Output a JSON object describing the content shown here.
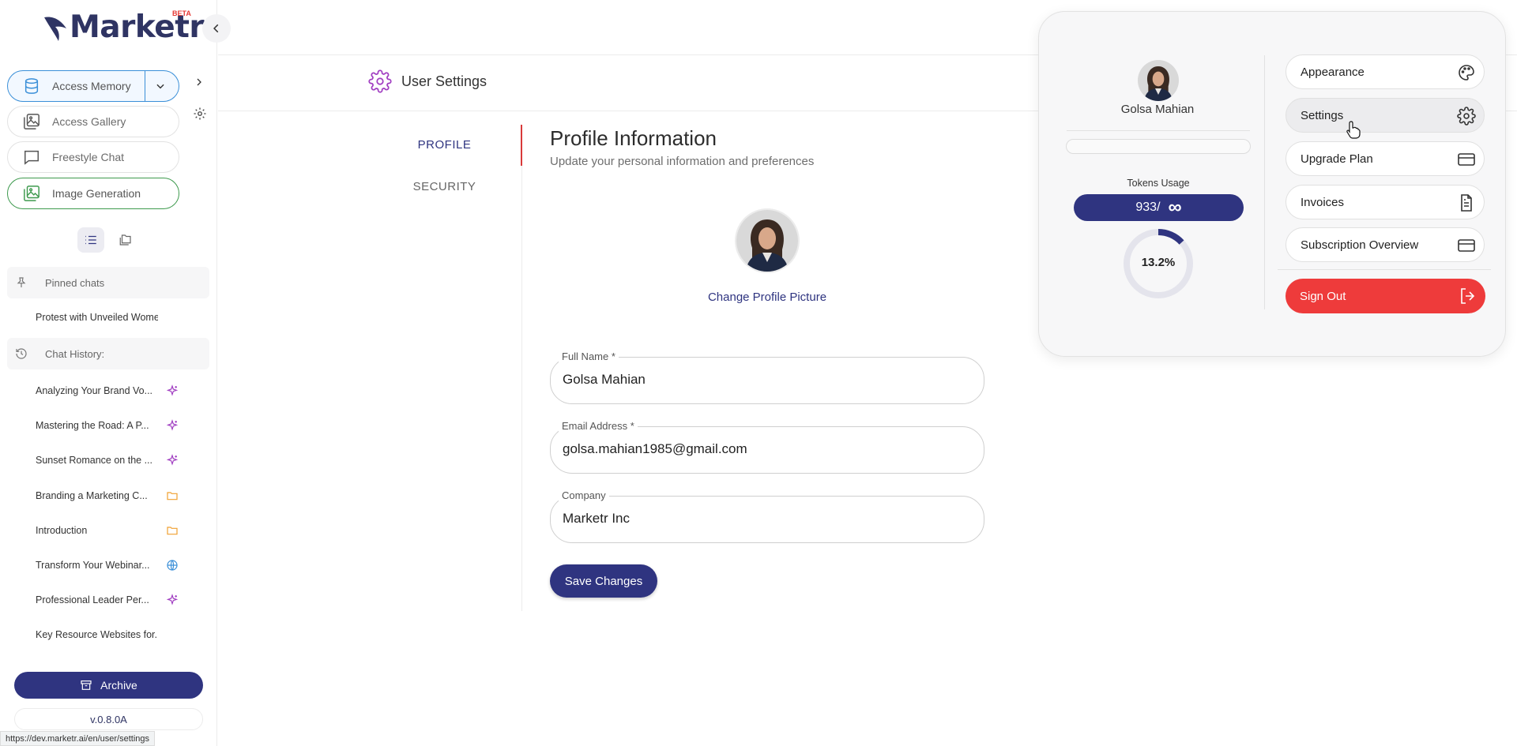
{
  "app": {
    "logo_text": "Marketr",
    "beta_label": "BETA",
    "version": "v.0.8.0A",
    "status_url": "https://dev.marketr.ai/en/user/settings"
  },
  "sidebar": {
    "buttons": [
      {
        "label": "Access Memory",
        "icon": "database-icon"
      },
      {
        "label": "Access Gallery",
        "icon": "gallery-icon"
      },
      {
        "label": "Freestyle Chat",
        "icon": "chat-bubble-icon"
      },
      {
        "label": "Image Generation",
        "icon": "image-gen-icon"
      }
    ],
    "pinned_header": "Pinned chats",
    "pinned_chats": [
      {
        "title": "Protest with Unveiled Women..."
      }
    ],
    "history_header": "Chat History:",
    "history": [
      {
        "title": "Analyzing Your Brand Vo...",
        "tag": "sparkle-icon"
      },
      {
        "title": "Mastering the Road: A P...",
        "tag": "sparkle-icon"
      },
      {
        "title": "Sunset Romance on the ...",
        "tag": "sparkle-icon"
      },
      {
        "title": "Branding a Marketing C...",
        "tag": "folder-icon"
      },
      {
        "title": "Introduction",
        "tag": "folder-icon"
      },
      {
        "title": "Transform Your Webinar...",
        "tag": "globe-icon"
      },
      {
        "title": "Professional Leader Per...",
        "tag": "sparkle-icon"
      },
      {
        "title": "Key Resource Websites for...",
        "tag": ""
      }
    ],
    "archive_label": "Archive"
  },
  "header": {
    "title": "User Settings"
  },
  "tabs": [
    {
      "label": "PROFILE",
      "active": true
    },
    {
      "label": "SECURITY",
      "active": false
    }
  ],
  "profile": {
    "title": "Profile Information",
    "subtitle": "Update your personal information and preferences",
    "change_picture": "Change Profile Picture",
    "fields": [
      {
        "label": "Full Name *",
        "value": "Golsa Mahian"
      },
      {
        "label": "Email Address *",
        "value": "golsa.mahian1985@gmail.com"
      },
      {
        "label": "Company",
        "value": "Marketr Inc"
      }
    ],
    "save_label": "Save Changes"
  },
  "popup": {
    "user_name": "Golsa Mahian",
    "tokens_label": "Tokens Usage",
    "tokens_value": "933/",
    "tokens_limit": "∞",
    "usage_percent_label": "13.2%",
    "usage_fraction": 0.132,
    "menu": [
      {
        "label": "Appearance",
        "icon": "palette-icon"
      },
      {
        "label": "Settings",
        "icon": "gear-icon"
      },
      {
        "label": "Upgrade Plan",
        "icon": "credit-card-icon"
      },
      {
        "label": "Invoices",
        "icon": "document-icon"
      },
      {
        "label": "Subscription Overview",
        "icon": "credit-card-icon"
      }
    ],
    "sign_out": "Sign Out"
  },
  "colors": {
    "brand": "#2f3480",
    "danger": "#ee3b3b",
    "tab_indicator": "#d93a3a",
    "memory_border": "#3a8fd8",
    "image_gen_border": "#3e9a4e",
    "sparkle": "#a13ec2",
    "folder": "#f0a030",
    "globe": "#3a8fd8"
  }
}
